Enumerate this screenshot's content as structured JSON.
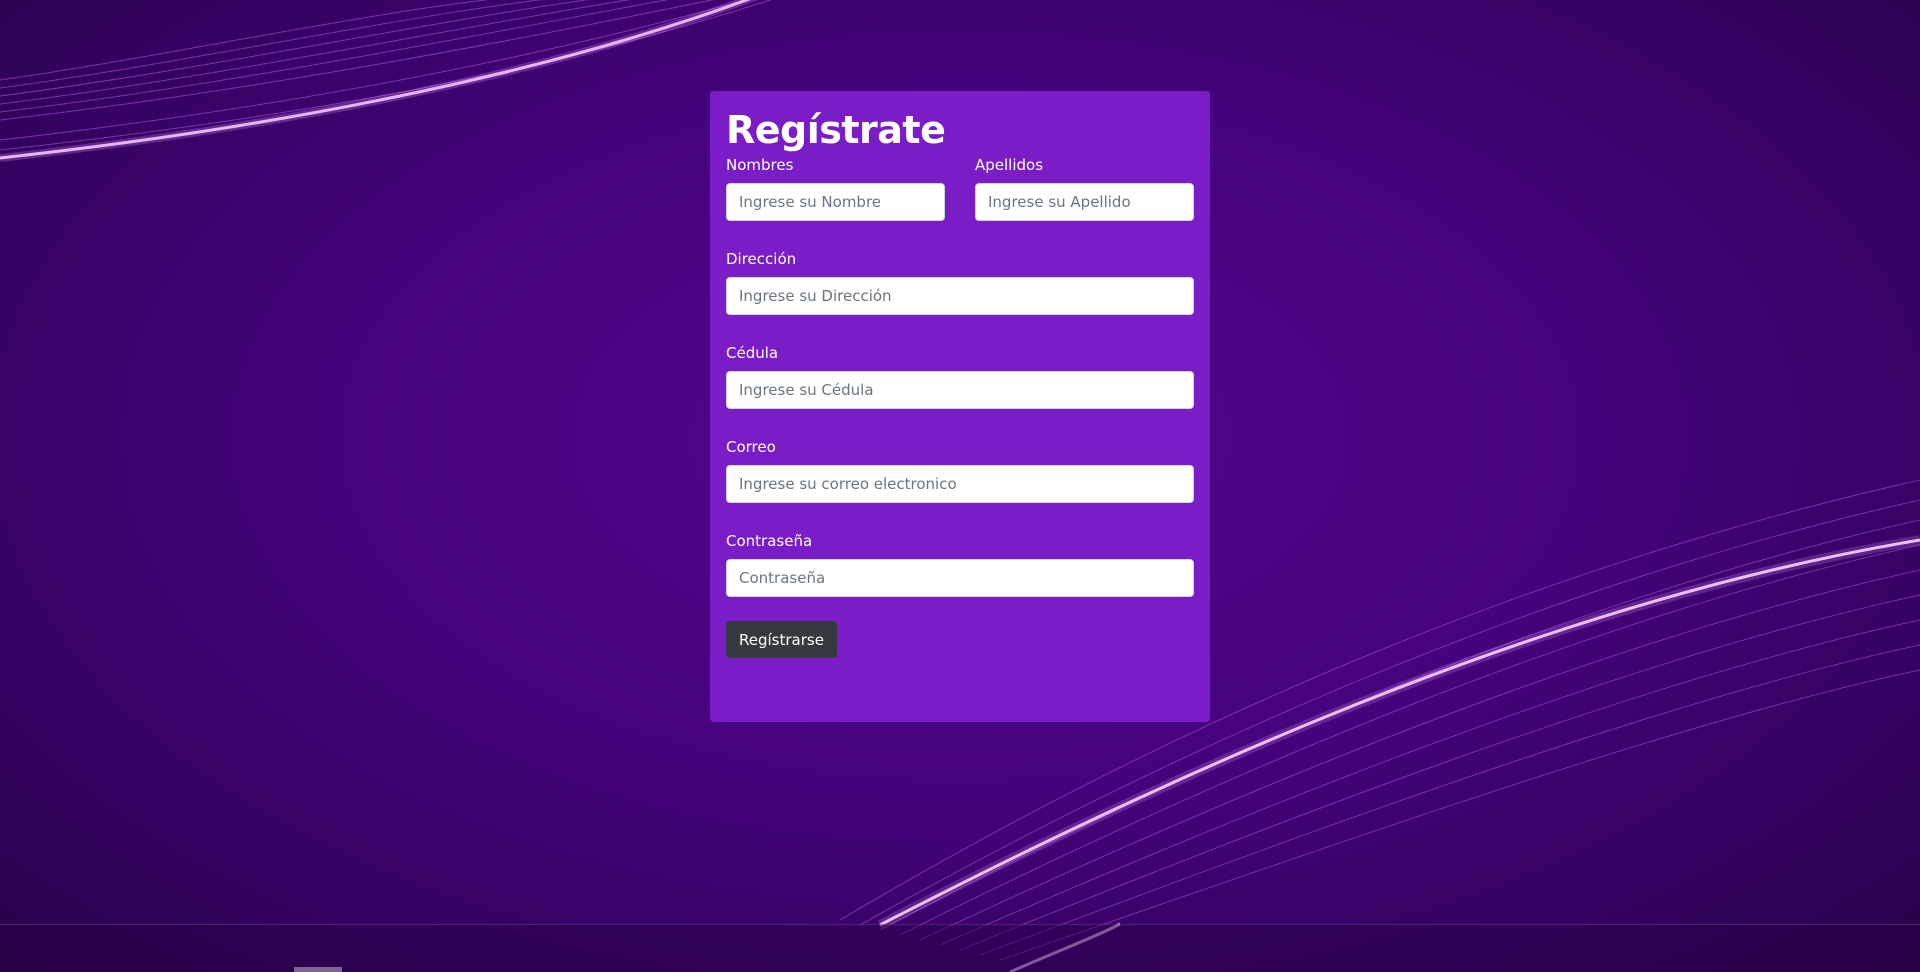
{
  "form": {
    "title": "Regístrate",
    "fields": {
      "nombres": {
        "label": "Nombres",
        "placeholder": "Ingrese su Nombre"
      },
      "apellidos": {
        "label": "Apellidos",
        "placeholder": "Ingrese su Apellido"
      },
      "direccion": {
        "label": "Dirección",
        "placeholder": "Ingrese su Dirección"
      },
      "cedula": {
        "label": "Cédula",
        "placeholder": "Ingrese su Cédula"
      },
      "correo": {
        "label": "Correo",
        "placeholder": "Ingrese su correo electronico"
      },
      "contrasena": {
        "label": "Contraseña",
        "placeholder": "Contraseña"
      }
    },
    "submit_label": "Regístrarse"
  },
  "colors": {
    "background": "#45037c",
    "card": "#7a1dc6",
    "button": "#343a40",
    "wave_highlight": "#f4c8ff"
  }
}
